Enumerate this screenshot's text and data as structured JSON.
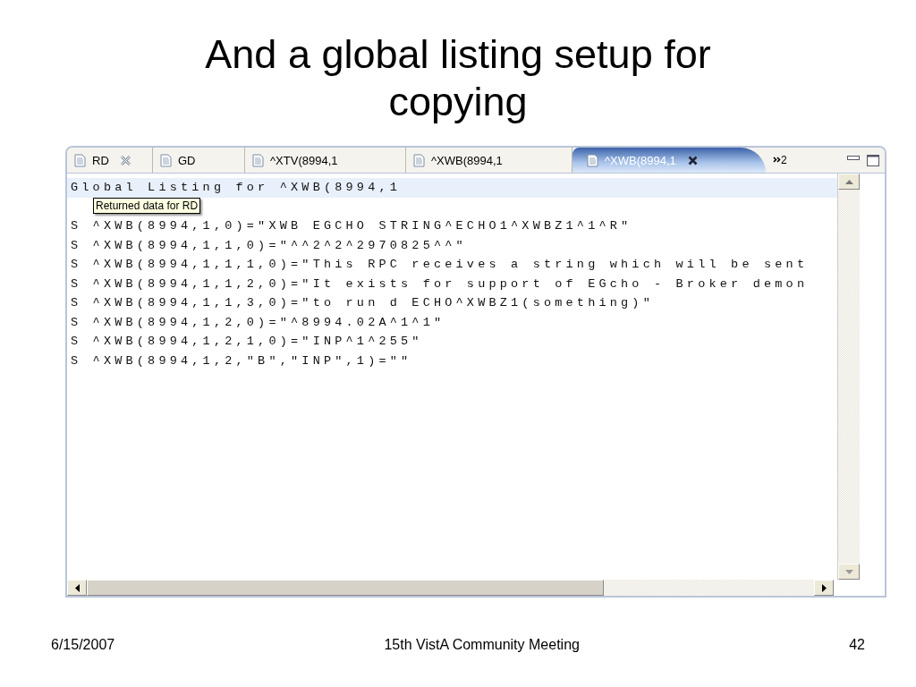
{
  "slide": {
    "title": "And a global listing setup for copying"
  },
  "editor": {
    "tabs": [
      {
        "label": "RD",
        "selected": false,
        "close_button": true
      },
      {
        "label": "GD",
        "selected": false,
        "close_button": false
      },
      {
        "label": "^XTV(8994,1",
        "selected": false,
        "close_button": false
      },
      {
        "label": "^XWB(8994,1",
        "selected": false,
        "close_button": false
      },
      {
        "label": "^XWB(8994,1",
        "selected": true,
        "close_button": true
      }
    ],
    "overflow_count": "2",
    "lines": [
      {
        "text": "Global Listing for ^XWB(8994,1",
        "highlighted": true
      },
      {
        "highlighted": false
      },
      {
        "text": "S ^XWB(8994,1,0)=\"XWB EGCHO STRING^ECHO1^XWBZ1^1^R\"",
        "highlighted": false
      },
      {
        "text": "S ^XWB(8994,1,1,0)=\"^^2^2^2970825^^\"",
        "highlighted": false
      },
      {
        "text": "S ^XWB(8994,1,1,1,0)=\"This RPC receives a string which will be sent",
        "highlighted": false
      },
      {
        "text": "S ^XWB(8994,1,1,2,0)=\"It exists for support of EGcho - Broker demon",
        "highlighted": false
      },
      {
        "text": "S ^XWB(8994,1,1,3,0)=\"to run d ECHO^XWBZ1(something)\"",
        "highlighted": false
      },
      {
        "text": "S ^XWB(8994,1,2,0)=\"^8994.02A^1^1\"",
        "highlighted": false
      },
      {
        "text": "S ^XWB(8994,1,2,1,0)=\"INP^1^255\"",
        "highlighted": false
      },
      {
        "text": "S ^XWB(8994,1,2,\"B\",\"INP\",1)=\"\"",
        "highlighted": false
      }
    ],
    "tooltip": "Returned data for RD"
  },
  "footer": {
    "date": "6/15/2007",
    "event": "15th VistA Community Meeting",
    "page": "42"
  }
}
